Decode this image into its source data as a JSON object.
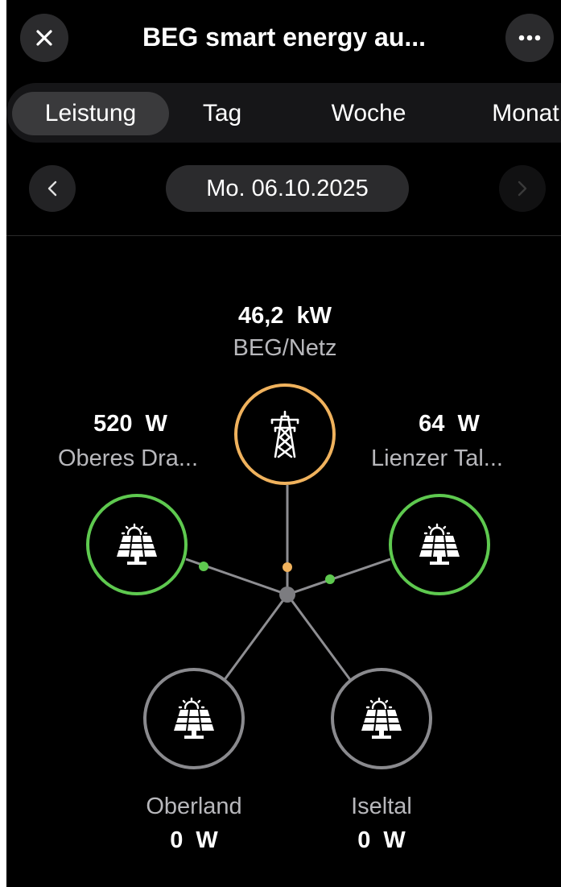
{
  "header": {
    "title": "BEG smart energy au...",
    "close_icon": "close-icon",
    "more_icon": "more-horizontal-icon"
  },
  "tabs": [
    {
      "label": "Leistung",
      "active": true
    },
    {
      "label": "Tag",
      "active": false
    },
    {
      "label": "Woche",
      "active": false
    },
    {
      "label": "Monat",
      "active": false
    }
  ],
  "date_nav": {
    "date": "Mo. 06.10.2025",
    "prev_icon": "chevron-left-icon",
    "next_icon": "chevron-right-icon",
    "next_enabled": false
  },
  "flow": {
    "grid": {
      "value": "46,2  kW",
      "label": "BEG/Netz",
      "icon": "power-pylon-icon",
      "color": "#f0b25d"
    },
    "producers": [
      {
        "id": "left",
        "value": "520  W",
        "label": "Oberes Dra...",
        "icon": "solar-panel-icon",
        "color": "#5ec94f"
      },
      {
        "id": "right",
        "value": "64  W",
        "label": "Lienzer Tal...",
        "icon": "solar-panel-icon",
        "color": "#5ec94f"
      },
      {
        "id": "bl",
        "value": "0  W",
        "label": "Oberland",
        "icon": "solar-panel-icon",
        "color": "#8a8a8e"
      },
      {
        "id": "br",
        "value": "0  W",
        "label": "Iseltal",
        "icon": "solar-panel-icon",
        "color": "#8a8a8e"
      }
    ]
  },
  "colors": {
    "background": "#000000",
    "active_green": "#5ec94f",
    "grid_orange": "#f0b25d",
    "inactive_grey": "#8a8a8e",
    "hub": "#7c7c80",
    "line": "#8e8e92"
  }
}
